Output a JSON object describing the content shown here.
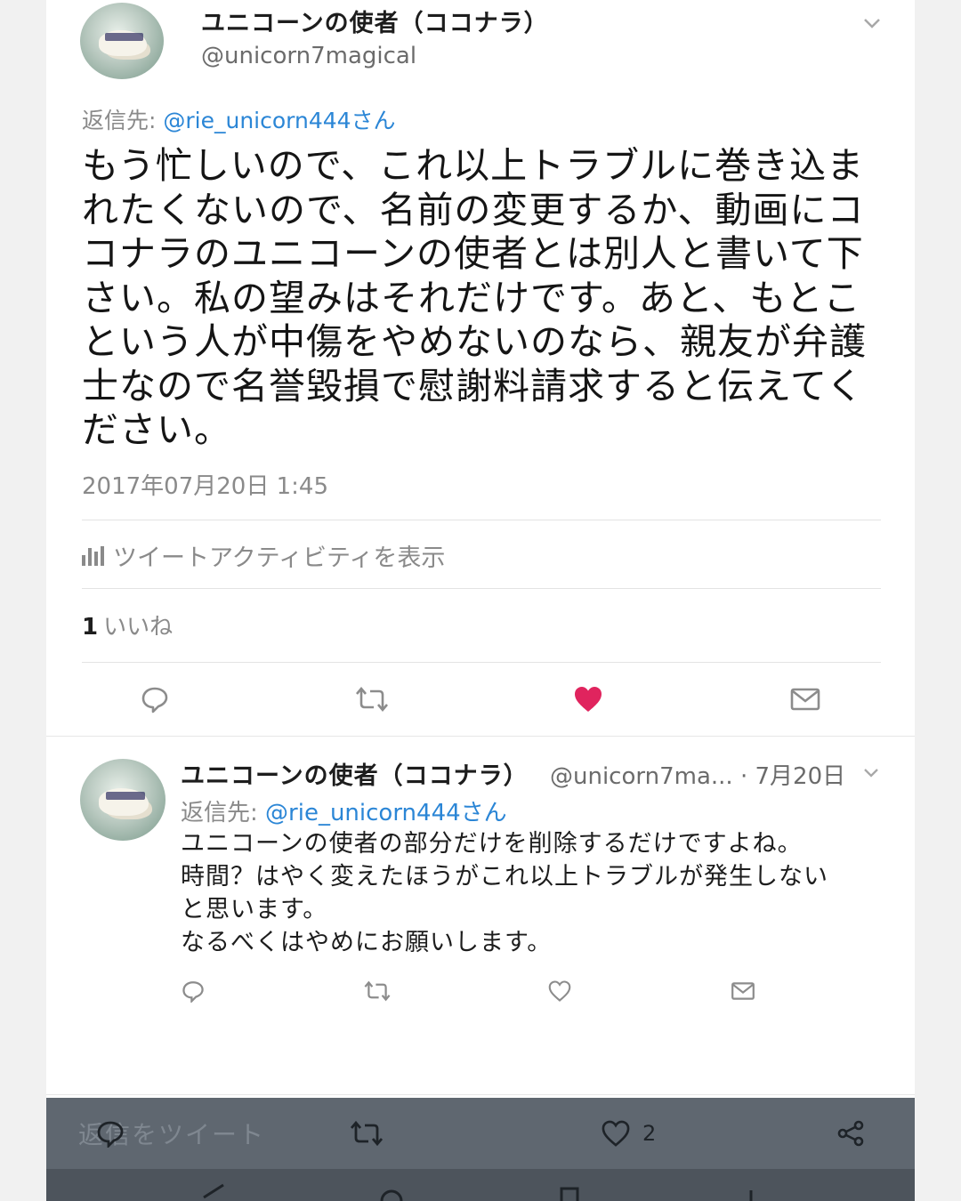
{
  "main_tweet": {
    "display_name": "ユニコーンの使者（ココナラ）",
    "handle": "@unicorn7magical",
    "reply_to_label": "返信先: ",
    "reply_to_user": "@rie_unicorn444さん",
    "body": "もう忙しいので、これ以上トラブルに巻き込まれたくないので、名前の変更するか、動画にココナラのユニコーンの使者とは別人と書いて下さい。私の望みはそれだけです。あと、もとこという人が中傷をやめないのなら、親友が弁護士なので名誉毀損で慰謝料請求すると伝えてください。",
    "timestamp": "2017年07月20日 1:45",
    "activity_label": "ツイートアクティビティを表示",
    "likes_count": "1",
    "likes_label": "いいね"
  },
  "reply_tweet": {
    "display_name": "ユニコーンの使者（ココナラ）",
    "meta": "@unicorn7ma... · 7月20日",
    "reply_to_label": "返信先: ",
    "reply_to_user": "@rie_unicorn444さん",
    "lines": [
      "ユニコーンの使者の部分だけを削除するだけですよね。",
      "時間？はやく変えたほうがこれ以上トラブルが発生しない",
      "と思います。",
      "なるべくはやめにお願いします。"
    ]
  },
  "bottom_bar": {
    "ghost_text": "返信をツイート",
    "like_count": "2"
  },
  "colors": {
    "link": "#2b86d6",
    "liked_heart": "#e0245e",
    "icon_gray": "#8c8c8c",
    "bottom_bar": "#5f6770"
  }
}
